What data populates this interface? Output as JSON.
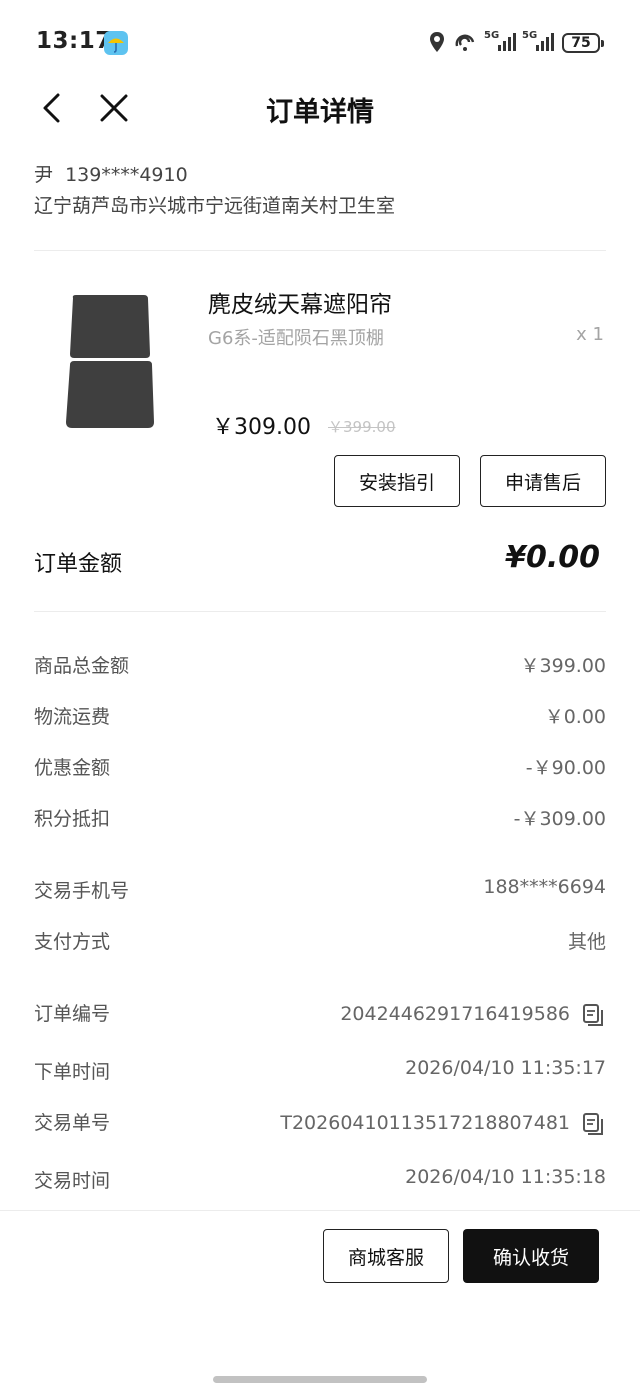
{
  "status_bar": {
    "time": "13:17",
    "network_1": "5G",
    "network_2": "5G",
    "battery": "75"
  },
  "header": {
    "title": "订单详情"
  },
  "address": {
    "name_phone": "尹  139****4910",
    "address": "辽宁葫芦岛市兴城市宁远街道南关村卫生室"
  },
  "product": {
    "name": "麂皮绒天幕遮阳帘",
    "spec": "G6系-适配陨石黑顶棚",
    "quantity": "x 1",
    "price": "￥309.00",
    "original_price": "￥399.00",
    "install_guide_label": "安装指引",
    "after_sales_label": "申请售后"
  },
  "order_amount": {
    "label": "订单金额",
    "value": "¥0.00"
  },
  "details": {
    "goods_total_label": "商品总金额",
    "goods_total_value": "￥399.00",
    "shipping_label": "物流运费",
    "shipping_value": "￥0.00",
    "discount_label": "优惠金额",
    "discount_value": "-￥90.00",
    "points_label": "积分抵扣",
    "points_value": "-￥309.00",
    "phone_label": "交易手机号",
    "phone_value": "188****6694",
    "payment_label": "支付方式",
    "payment_value": "其他",
    "order_no_label": "订单编号",
    "order_no_value": "2042446291716419586",
    "order_time_label": "下单时间",
    "order_time_value": "2026/04/10 11:35:17",
    "trade_no_label": "交易单号",
    "trade_no_value": "T2026041011351721880​7481",
    "trade_time_label": "交易时间",
    "trade_time_value": "2026/04/10 11:35:18"
  },
  "footer": {
    "service_label": "商城客服",
    "confirm_label": "确认收货"
  },
  "icons": {
    "back": "chevron-left-icon",
    "close": "close-icon",
    "copy": "copy-icon",
    "location": "location-icon",
    "umbrella": "umbrella-icon"
  }
}
